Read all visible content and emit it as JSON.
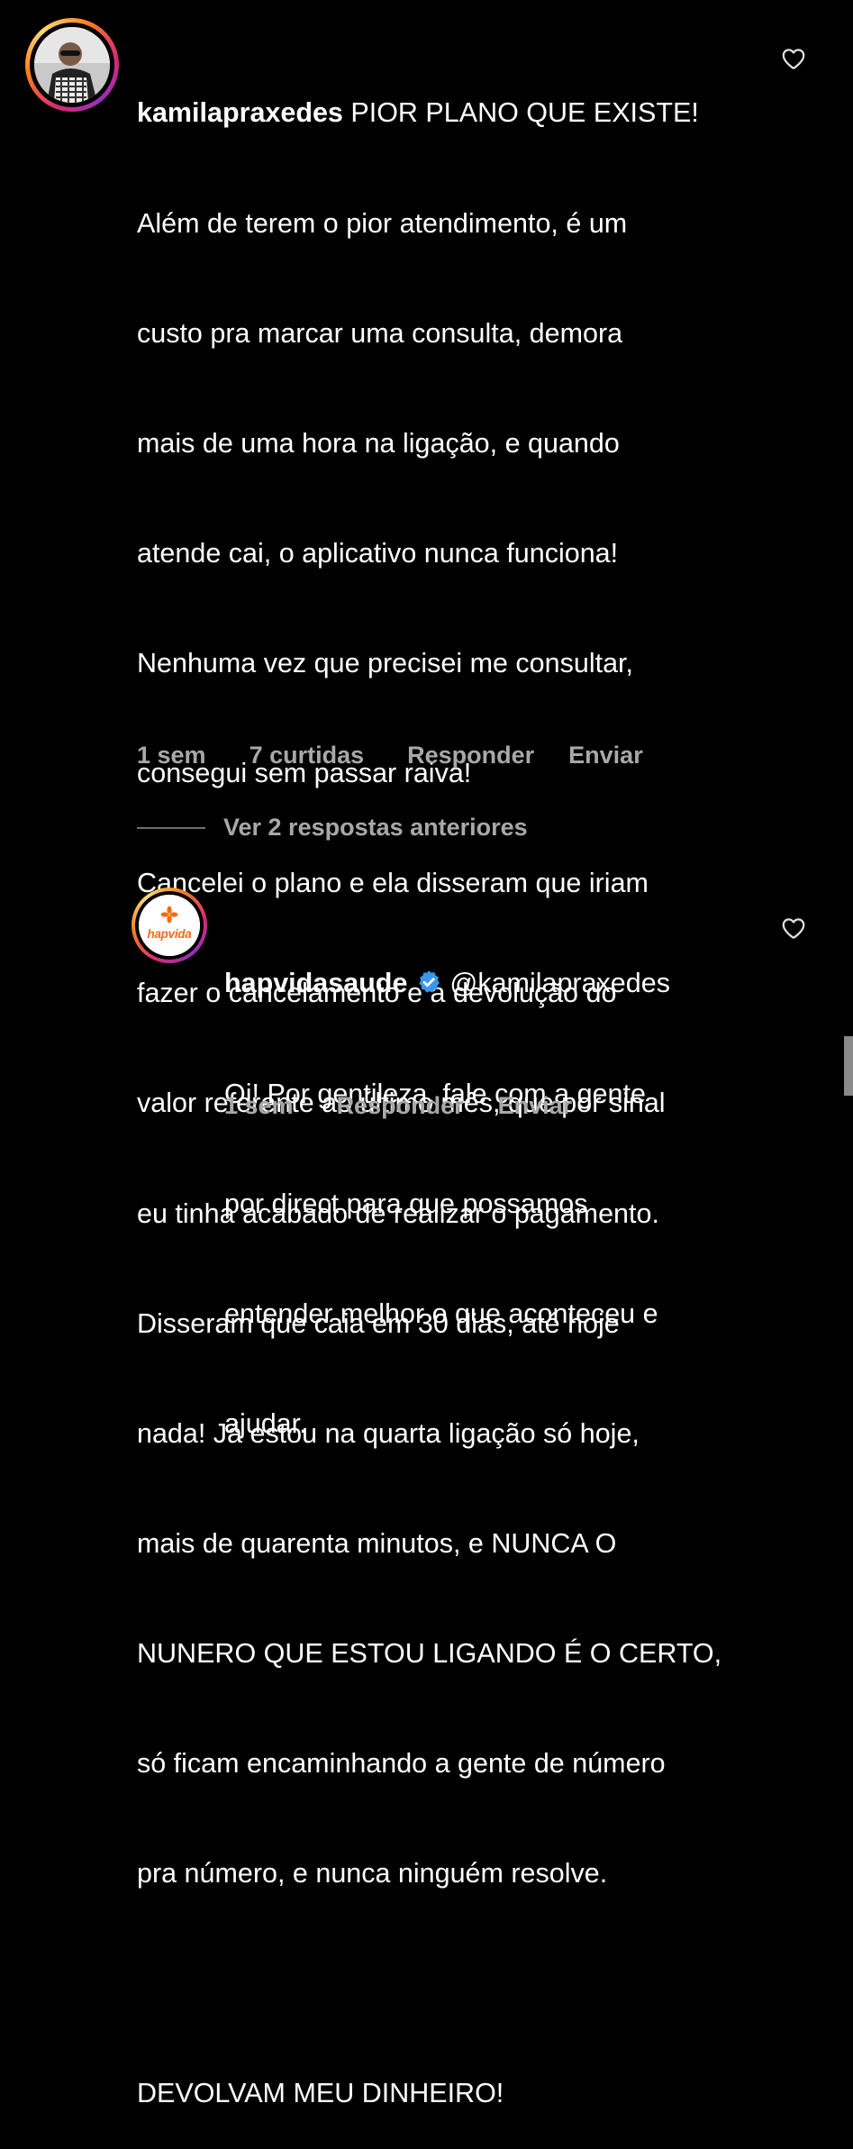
{
  "comment": {
    "username": "kamilapraxedes",
    "lines": [
      "PIOR PLANO QUE EXISTE!",
      "Além de terem o pior atendimento, é um",
      "custo pra marcar uma consulta, demora",
      "mais de uma hora na ligação, e quando",
      "atende cai, o aplicativo nunca funciona!",
      "Nenhuma vez que precisei me consultar,",
      "consegui sem passar raiva!",
      "Cancelei o plano e ela disseram que iriam",
      "fazer o cancelamento e a devolução do",
      "valor referente ao último mês, que por sinal",
      "eu tinha acabado de realizar o pagamento.",
      "Disseram que caia em 30 dias, até hoje",
      "nada! Já estou na quarta ligação só hoje,",
      "mais de quarenta minutos, e NUNCA O",
      "NUNERO QUE ESTOU LIGANDO É O CERTO,",
      "só ficam encaminhando a gente de número",
      "pra número, e nunca ninguém resolve.",
      "",
      "DEVOLVAM MEU DINHEIRO!"
    ],
    "time": "1 sem",
    "likes": "7 curtidas",
    "reply_label": "Responder",
    "send_label": "Enviar"
  },
  "view_replies": "Ver 2 respostas anteriores",
  "reply": {
    "username": "hapvidasaude",
    "mention": "@kamilapraxedes",
    "avatar_logo_text": "hapvida",
    "lines": [
      "Oi! Por gentileza, fale com a gente",
      "por direct para que possamos",
      "entender melhor o que aconteceu e",
      "ajudar."
    ],
    "time": "1 sem",
    "reply_label": "Responder",
    "send_label": "Enviar"
  },
  "colors": {
    "background": "#000000",
    "text": "#ffffff",
    "meta": "#a8a8a8",
    "verified": "#3897f0",
    "brand_orange": "#f26b1d"
  }
}
